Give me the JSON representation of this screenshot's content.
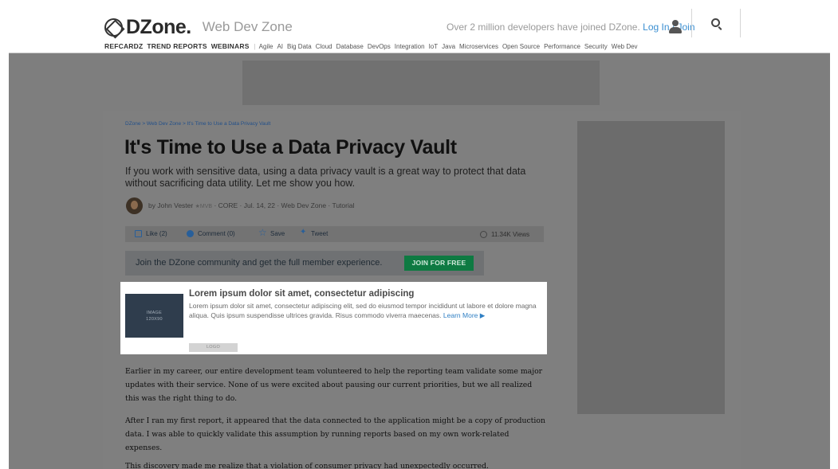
{
  "header": {
    "brand": "DZone.",
    "zone_name": "Web Dev Zone",
    "join_prefix": "Over 2 million developers have joined DZone.",
    "login_join": "Log In / Join",
    "user_icon": "user-icon",
    "search_icon": "search-icon"
  },
  "nav": {
    "primary": [
      "REFCARDZ",
      "TREND REPORTS",
      "WEBINARS"
    ],
    "topics": [
      "Agile",
      "AI",
      "Big Data",
      "Cloud",
      "Database",
      "DevOps",
      "Integration",
      "IoT",
      "Java",
      "Microservices",
      "Open Source",
      "Performance",
      "Security",
      "Web Dev"
    ]
  },
  "article": {
    "breadcrumb": "DZone > Web Dev Zone > It's Time to Use a Data Privacy Vault",
    "title": "It's Time to Use a Data Privacy Vault",
    "subtitle": "If you work with sensitive data, using a data privacy vault is a great way to protect that data without sacrificing data utility. Let me show you how.",
    "author_prefix": "by John Vester",
    "author_badge": "★MVB",
    "byline_rest": "· CORE · Jul. 14, 22 · Web Dev Zone · Tutorial"
  },
  "actions": {
    "like": "Like (2)",
    "comment": "Comment (0)",
    "save": "Save",
    "tweet": "Tweet",
    "views": "11.34K Views"
  },
  "join_banner": {
    "text": "Join the DZone community and get the full member experience.",
    "button": "JOIN FOR FREE"
  },
  "native_ad": {
    "image_label_1": "IMAGE",
    "image_label_2": "120X90",
    "title": "Lorem ipsum dolor sit amet, consectetur adipiscing",
    "body": "Lorem ipsum dolor sit amet, consectetur adipiscing elit, sed do eiusmod tempor incididunt ut labore et dolore magna aliqua. Quis ipsum suspendisse ultrices gravida. Risus commodo viverra maecenas.",
    "learn_more": "Learn More ▶",
    "logo_label": "LOGO"
  },
  "body": {
    "p1": "Earlier in my career, our entire development team volunteered to help the reporting team validate some major updates with their service. None of us were excited about pausing our current priorities, but we all realized this was the right thing to do.",
    "p2": "After I ran my first report, it appeared that the data connected to the application might be a copy of production data. I was able to quickly validate this assumption by running reports based on my own work-related expenses.",
    "p3": "This discovery made me realize that a violation of consumer privacy had unexpectedly occurred."
  },
  "colors": {
    "overlay": "#7e7e7e",
    "link_blue": "#3b8fd1",
    "join_green": "#0e7a42",
    "ad_image_bg": "#2f3d4d"
  }
}
